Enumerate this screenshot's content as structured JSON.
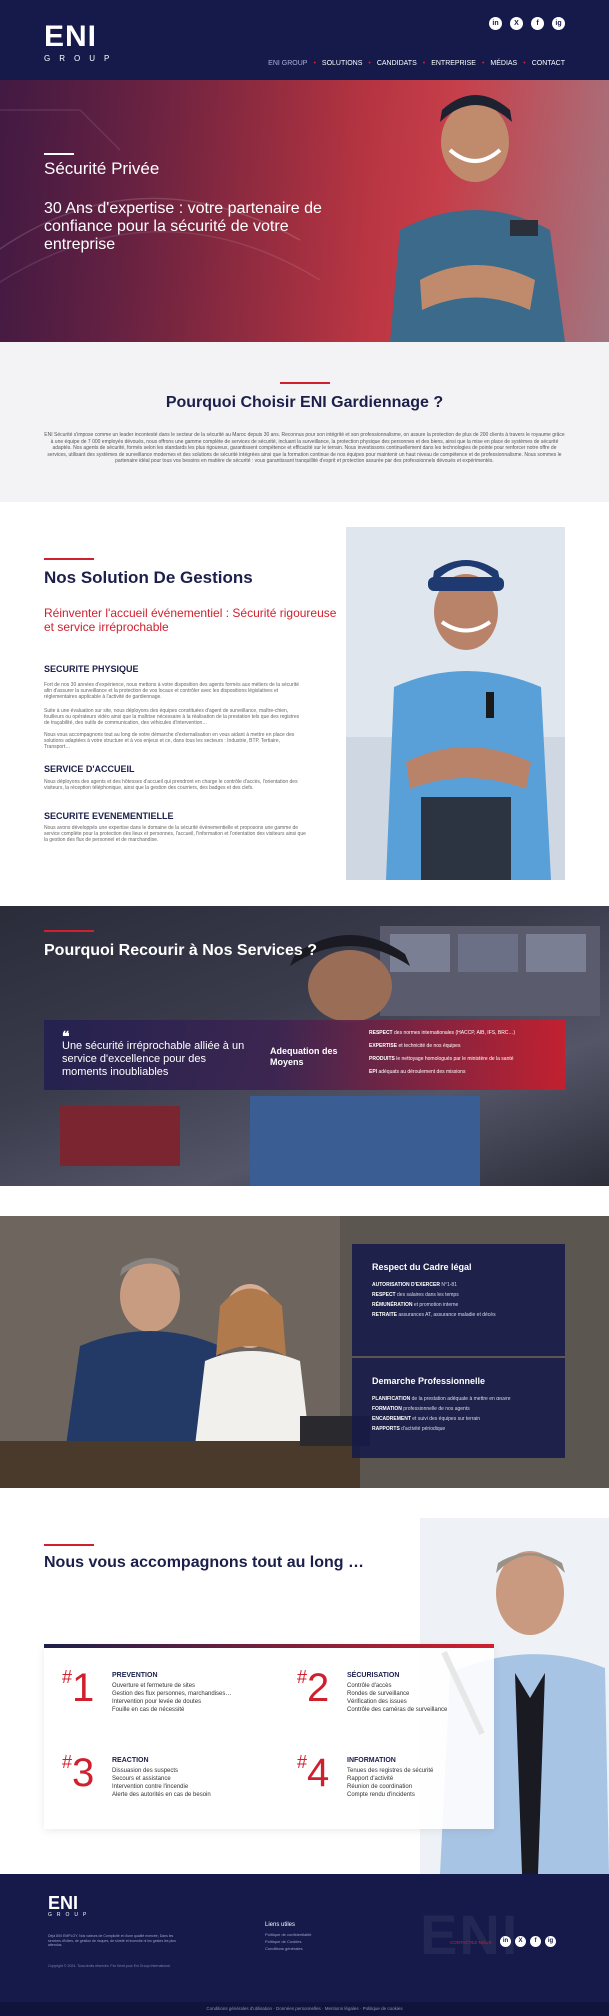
{
  "header": {
    "logo_text": "ENI",
    "logo_sub": "GROUP",
    "socials": [
      "in",
      "X",
      "f",
      "ig"
    ],
    "nav": [
      "ENI GROUP",
      "SOLUTIONS",
      "CANDIDATS",
      "ENTREPRISE",
      "MÉDIAS",
      "CONTACT"
    ]
  },
  "hero": {
    "title": "Sécurité Privée",
    "subtitle": "30 Ans d'expertise : votre partenaire de confiance pour la sécurité de votre entreprise"
  },
  "why": {
    "title": "Pourquoi Choisir ENI Gardiennage ?",
    "text": "ENI Sécurité s'impose comme un leader incontesté dans le secteur de la sécurité au Maroc depuis 30 ans. Reconnus pour son intégrité et son professionnalisme, on assure la protection de plus de 200 clients à travers le royaume grâce à une équipe de 7 000 employés dévoués, nous offrons une gamme complète de services de sécurité, incluant la surveillance, la protection physique des personnes et des biens, ainsi que la mise en place de systèmes de sécurité adaptés. Nos agents de sécurité, formés selon les standards les plus rigoureux, garantissent compétence et efficacité sur le terrain. Nous investissons continuellement dans les technologies de pointe pour renforcer notre offre de services, utilisant des systèmes de surveillance modernes et des solutions de sécurité intégrées ainsi que la formation continue de nos équipes pour maintenir un haut niveau de compétence et de professionnalisme. Nous sommes le partenaire idéal pour tous vos besoins en matière de sécurité : vous garantissant tranquillité d'esprit et protection assurée par des professionnels dévoués et expérimentés."
  },
  "solutions": {
    "title": "Nos Solution De Gestions",
    "tagline": "Réinventer l'accueil événementiel : Sécurité rigoureuse et service irréprochable",
    "sections": [
      {
        "heading": "SECURITE PHYSIQUE",
        "paragraphs": [
          "Fort de nos 30 années d'expérience, nous mettons à votre disposition des agents formés aux métiers de la sécurité afin d'assurer la surveillance et la protection de vos locaux et contrôler avec les dispositions législatives et réglementaires applicable à l'activité de gardiennage.",
          "Suite à une évaluation sur site, nous déployons des équipes constituées d'agent de surveillance, maître-chien, fouilleurs ou opérateurs vidéo ainsi que la maîtrise nécessaire à la réalisation de la prestation tels que des registres de traçabilité, des outils de communication, des véhicules d'intervention…",
          "Nous vous accompagnons tout au long de votre démarche d'externalisation en vous aidant à mettre en place des solutions adaptées à votre structure et à vos enjeux et ce, dans tous les secteurs : Industrie, BTP, Tertiaire, Transport…"
        ]
      },
      {
        "heading": "SERVICE D'ACCUEIL",
        "paragraphs": [
          "Nous déployons des agents et des hôtesses d'accueil qui prendront en charge le contrôle d'accès, l'orientation des visiteurs, la réception téléphonique, ainsi que la gestion des courriers, des badges et des clefs."
        ]
      },
      {
        "heading": "SECURITE EVENEMENTIELLE",
        "paragraphs": [
          "Nous avons développés une expertise dans le domaine de la sécurité événementielle et proposons une gamme de service complète pour la protection des lieux et personnes, l'accueil, l'information et l'orientation des visiteurs ainsi que la gestion des flux de personnel et de marchandise."
        ]
      }
    ]
  },
  "recourir": {
    "title": "Pourquoi Recourir à Nos Services ?",
    "quote_mark": "❝",
    "quote": "Une sécurité irréprochable alliée à un service d'excellence pour des moments inoubliables",
    "adequation": "Adequation des Moyens",
    "items": [
      {
        "bold": "RESPECT",
        "text": " des normes internationales (HACCP, AIB, IFS, BRC…)"
      },
      {
        "bold": "EXPERTISE",
        "text": " et technicité de nos équipes"
      },
      {
        "bold": "PRODUITS",
        "text": " le nettoyage homologués par le ministère de la santé"
      },
      {
        "bold": "EPI",
        "text": " adéquats au déroulement des missions"
      }
    ]
  },
  "legal": {
    "panel1": {
      "title": "Respect du Cadre légal",
      "lines": [
        {
          "bold": "AUTORISATION D'EXERCER",
          "text": " N°1-81"
        },
        {
          "bold": "RESPECT",
          "text": " des salaires dans les temps"
        },
        {
          "bold": "RÉMUNÉRATION",
          "text": " et promotion interne"
        },
        {
          "bold": "RETRAITE",
          "text": " assurances AT, assurance maladie et décès"
        }
      ]
    },
    "panel2": {
      "title": "Demarche Professionnelle",
      "lines": [
        {
          "bold": "PLANIFICATION",
          "text": " de la prestation adéquate à mettre en œuvre"
        },
        {
          "bold": "FORMATION",
          "text": " professionnelle de nos agents"
        },
        {
          "bold": "ENCADREMENT",
          "text": " et suivi des équipes sur terrain"
        },
        {
          "bold": "RAPPORTS",
          "text": " d'activité périodique"
        }
      ]
    }
  },
  "accompagnons": {
    "title": "Nous vous accompagnons tout au long …",
    "steps": [
      {
        "num": "1",
        "title": "PREVENTION",
        "items": [
          "Ouverture et fermeture de sites",
          "Gestion des flux personnes, marchandises…",
          "Intervention pour levée de doutes",
          "Fouille en cas de nécessité"
        ]
      },
      {
        "num": "2",
        "title": "SÉCURISATION",
        "items": [
          "Contrôle d'accès",
          "Rondes de surveillance",
          "Vérification des issues",
          "Contrôle des caméras de surveillance"
        ]
      },
      {
        "num": "3",
        "title": "REACTION",
        "items": [
          "Dissuasion des suspects",
          "Secours et assistance",
          "Intervention contre l'incendie",
          "Alerte des autorités en cas de besoin"
        ]
      },
      {
        "num": "4",
        "title": "INFORMATION",
        "items": [
          "Tenues des registres de sécurité",
          "Rapport d'activité",
          "Réunion de coordination",
          "Compte rendu d'incidents"
        ]
      }
    ]
  },
  "footer": {
    "logo_text": "ENI",
    "logo_sub": "GROUP",
    "description": "Déjà 800 EMPLOY. Nos valeurs de Complicité et d'une qualité exercée, Dans les services d'hôtes, de gestion de risques, de sûreté et incendie ni les gestes les plus attendus.",
    "copyright": "Copyright © 2024. Tous droits réservés. Par Xenit pour Eni Group International.",
    "links_title": "Liens utiles",
    "links": [
      "Politique de confidentialité",
      "Politique de Cookies",
      "Conditions générales"
    ],
    "contact": "CONTACTEZ-NOUS",
    "bottom": "Conditions générales d'utilisation · Données personnelles · Mentions légales · Politique de cookies",
    "watermark": "ENI"
  }
}
